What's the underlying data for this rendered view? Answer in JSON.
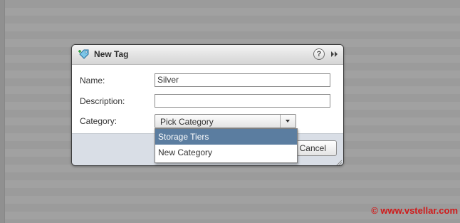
{
  "dialog": {
    "title": "New Tag",
    "title_icon": "tag-icon",
    "help_label": "?",
    "expand_icon": "double-arrow-right-icon"
  },
  "form": {
    "name_label": "Name:",
    "name_value": "Silver",
    "description_label": "Description:",
    "description_value": "",
    "category_label": "Category:",
    "category_selected": "Pick Category"
  },
  "dropdown": {
    "options": [
      "Storage Tiers",
      "New Category"
    ],
    "highlighted_index": 0
  },
  "footer": {
    "cancel_label": "Cancel"
  },
  "watermark": "© www.vstellar.com",
  "colors": {
    "selection": "#5b7da0",
    "watermark": "#d01a1a",
    "footer": "#d9dee6"
  }
}
